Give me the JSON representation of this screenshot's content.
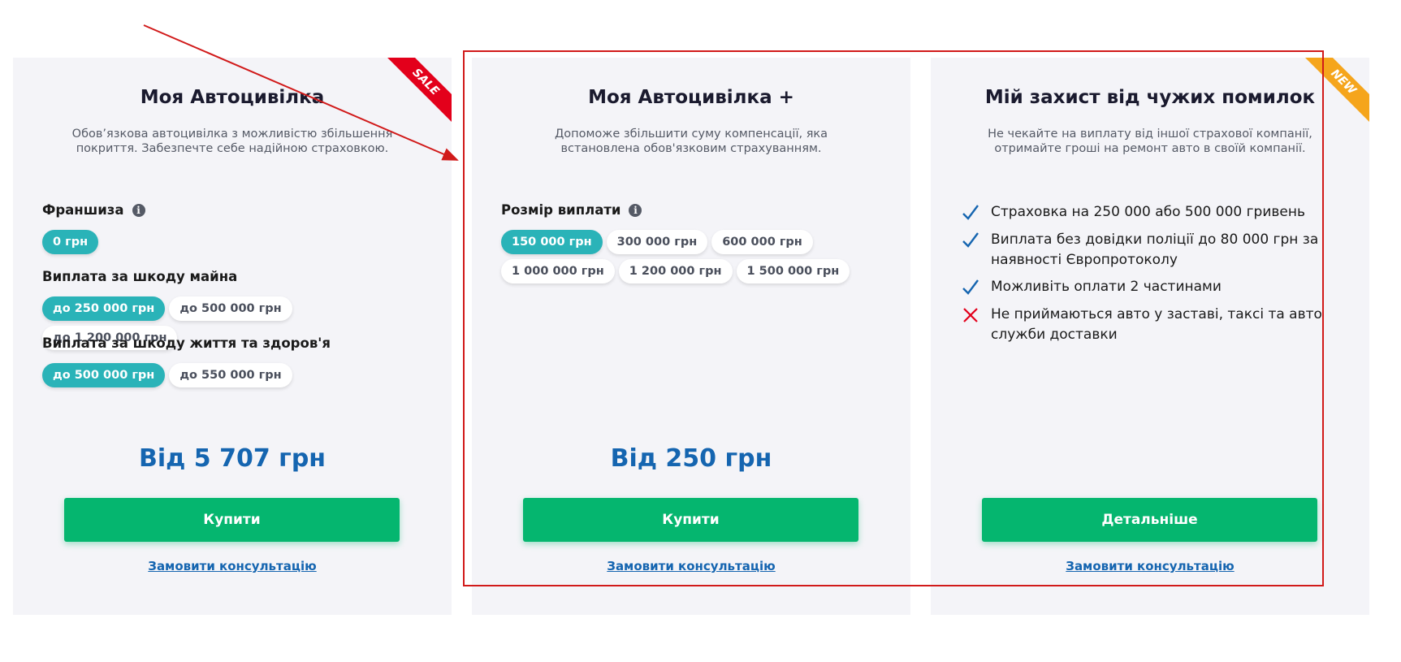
{
  "colors": {
    "accent_teal": "#2ab3b8",
    "button_green": "#05b66f",
    "price_blue": "#1565b0",
    "card_bg": "#f4f4f8",
    "annotation_red": "#d11a1a",
    "sale_red": "#e3001b",
    "new_orange": "#f5a51c"
  },
  "cards": [
    {
      "badge": "SALE",
      "title": "Моя Автоцивілка",
      "description": "Обов’язкова автоцивілка з можливістю збільшення покриття. Забезпечте себе надійною страховкою.",
      "groups": [
        {
          "label": "Франшиза",
          "has_info_icon": true,
          "options": [
            "0 грн"
          ],
          "selected": "0 грн"
        },
        {
          "label": "Виплата за шкоду майна",
          "has_info_icon": false,
          "options": [
            "до 250 000 грн",
            "до 500 000 грн",
            "до 1 200 000 грн"
          ],
          "selected": "до 250 000 грн"
        },
        {
          "label": "Виплата за шкоду життя та здоров'я",
          "has_info_icon": false,
          "options": [
            "до 500 000 грн",
            "до 550 000 грн"
          ],
          "selected": "до 500 000 грн"
        }
      ],
      "price": "Від 5 707 грн",
      "button": "Купити",
      "consult_link": "Замовити консультацію"
    },
    {
      "badge": "",
      "title": "Моя Автоцивілка +",
      "description": "Допоможе збільшити суму компенсації, яка встановлена обов'язковим страхуванням.",
      "groups": [
        {
          "label": "Розмір виплати",
          "has_info_icon": true,
          "options": [
            "150 000 грн",
            "300 000 грн",
            "600 000 грн",
            "1 000 000 грн",
            "1 200 000 грн",
            "1 500 000 грн"
          ],
          "selected": "150 000 грн"
        }
      ],
      "price": "Від 250 грн",
      "button": "Купити",
      "consult_link": "Замовити консультацію"
    },
    {
      "badge": "NEW",
      "title": "Мій захист від чужих помилок",
      "description": "Не чекайте на виплату від іншої страхової компанії, отримайте гроші на ремонт авто в своїй компанії.",
      "features": [
        {
          "icon": "check-icon",
          "text": "Страховка на 250 000 або 500 000 гривень"
        },
        {
          "icon": "check-icon",
          "text": "Виплата без довідки поліції до 80 000 грн за наявності Європротоколу"
        },
        {
          "icon": "check-icon",
          "text": "Можливіть оплати 2 частинами"
        },
        {
          "icon": "cross-icon",
          "text": "Не приймаються авто у заставі, таксі та авто служби доставки"
        }
      ],
      "button": "Детальніше",
      "consult_link": "Замовити консультацію"
    }
  ]
}
